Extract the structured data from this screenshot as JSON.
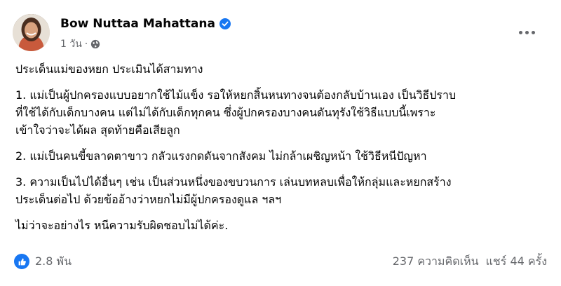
{
  "post": {
    "author": "Bow Nuttaa Mahattana",
    "time": "1 วัน",
    "time_separator": "·",
    "paragraphs": [
      [
        "ประเด็นแม่ของหยก ประเมินได้สามทาง"
      ],
      [
        "1. แม่เป็นผู้ปกครองแบบอยากใช้ไม้แข็ง รอให้หยกสิ้นหนทางจนต้องกลับบ้านเอง เป็นวิธีปราบ",
        "ที่ใช้ได้กับเด็กบางคน แต่ไม่ได้กับเด็กทุกคน ซึ่งผู้ปกครองบางคนดันทุรังใช้วิธีแบบนี้เพราะ",
        "เข้าใจว่าจะได้ผล สุดท้ายคือเสียลูก"
      ],
      [
        "2. แม่เป็นคนขี้ขลาดตาขาว กลัวแรงกดดันจากสังคม ไม่กล้าเผชิญหน้า ใช้วิธีหนีปัญหา"
      ],
      [
        "3. ความเป็นไปได้อื่นๆ เช่น เป็นส่วนหนึ่งของขบวนการ เล่นบทหลบเพื่อให้กลุ่มและหยกสร้าง",
        "ประเด็นต่อไป ด้วยข้ออ้างว่าหยกไม่มีผู้ปกครองดูแล ฯลฯ"
      ],
      [
        "ไม่ว่าจะอย่างไร หนีความรับผิดชอบไม่ได้ค่ะ."
      ]
    ]
  },
  "footer": {
    "reactions_count": "2.8 พัน",
    "comments": "237 ความคิดเห็น",
    "shares": "แชร์ 44 ครั้ง"
  },
  "colors": {
    "accent": "#1877f2",
    "text": "#050505",
    "secondary_text": "#65676b"
  },
  "icons": {
    "verified": "verified-badge-icon",
    "audience": "globe-icon",
    "more": "more-options-icon",
    "like": "like-reaction-icon"
  }
}
